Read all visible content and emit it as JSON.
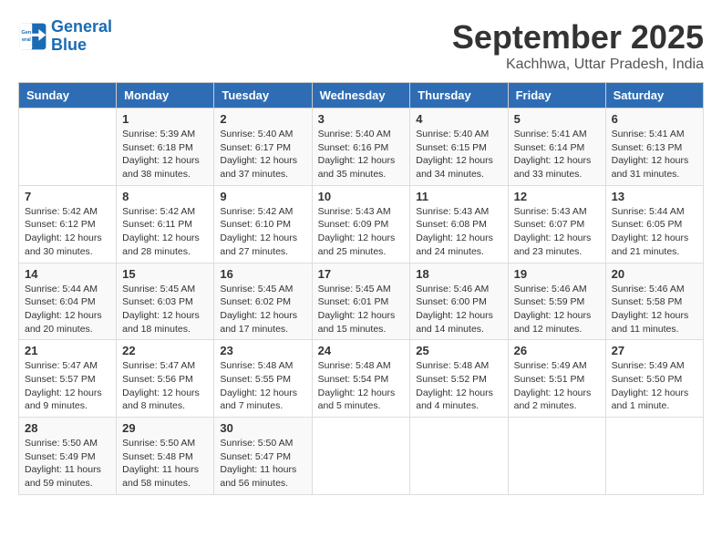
{
  "logo": {
    "line1": "General",
    "line2": "Blue"
  },
  "title": "September 2025",
  "location": "Kachhwa, Uttar Pradesh, India",
  "headers": [
    "Sunday",
    "Monday",
    "Tuesday",
    "Wednesday",
    "Thursday",
    "Friday",
    "Saturday"
  ],
  "weeks": [
    [
      null,
      {
        "day": "1",
        "sunrise": "Sunrise: 5:39 AM",
        "sunset": "Sunset: 6:18 PM",
        "daylight": "Daylight: 12 hours and 38 minutes."
      },
      {
        "day": "2",
        "sunrise": "Sunrise: 5:40 AM",
        "sunset": "Sunset: 6:17 PM",
        "daylight": "Daylight: 12 hours and 37 minutes."
      },
      {
        "day": "3",
        "sunrise": "Sunrise: 5:40 AM",
        "sunset": "Sunset: 6:16 PM",
        "daylight": "Daylight: 12 hours and 35 minutes."
      },
      {
        "day": "4",
        "sunrise": "Sunrise: 5:40 AM",
        "sunset": "Sunset: 6:15 PM",
        "daylight": "Daylight: 12 hours and 34 minutes."
      },
      {
        "day": "5",
        "sunrise": "Sunrise: 5:41 AM",
        "sunset": "Sunset: 6:14 PM",
        "daylight": "Daylight: 12 hours and 33 minutes."
      },
      {
        "day": "6",
        "sunrise": "Sunrise: 5:41 AM",
        "sunset": "Sunset: 6:13 PM",
        "daylight": "Daylight: 12 hours and 31 minutes."
      }
    ],
    [
      {
        "day": "7",
        "sunrise": "Sunrise: 5:42 AM",
        "sunset": "Sunset: 6:12 PM",
        "daylight": "Daylight: 12 hours and 30 minutes."
      },
      {
        "day": "8",
        "sunrise": "Sunrise: 5:42 AM",
        "sunset": "Sunset: 6:11 PM",
        "daylight": "Daylight: 12 hours and 28 minutes."
      },
      {
        "day": "9",
        "sunrise": "Sunrise: 5:42 AM",
        "sunset": "Sunset: 6:10 PM",
        "daylight": "Daylight: 12 hours and 27 minutes."
      },
      {
        "day": "10",
        "sunrise": "Sunrise: 5:43 AM",
        "sunset": "Sunset: 6:09 PM",
        "daylight": "Daylight: 12 hours and 25 minutes."
      },
      {
        "day": "11",
        "sunrise": "Sunrise: 5:43 AM",
        "sunset": "Sunset: 6:08 PM",
        "daylight": "Daylight: 12 hours and 24 minutes."
      },
      {
        "day": "12",
        "sunrise": "Sunrise: 5:43 AM",
        "sunset": "Sunset: 6:07 PM",
        "daylight": "Daylight: 12 hours and 23 minutes."
      },
      {
        "day": "13",
        "sunrise": "Sunrise: 5:44 AM",
        "sunset": "Sunset: 6:05 PM",
        "daylight": "Daylight: 12 hours and 21 minutes."
      }
    ],
    [
      {
        "day": "14",
        "sunrise": "Sunrise: 5:44 AM",
        "sunset": "Sunset: 6:04 PM",
        "daylight": "Daylight: 12 hours and 20 minutes."
      },
      {
        "day": "15",
        "sunrise": "Sunrise: 5:45 AM",
        "sunset": "Sunset: 6:03 PM",
        "daylight": "Daylight: 12 hours and 18 minutes."
      },
      {
        "day": "16",
        "sunrise": "Sunrise: 5:45 AM",
        "sunset": "Sunset: 6:02 PM",
        "daylight": "Daylight: 12 hours and 17 minutes."
      },
      {
        "day": "17",
        "sunrise": "Sunrise: 5:45 AM",
        "sunset": "Sunset: 6:01 PM",
        "daylight": "Daylight: 12 hours and 15 minutes."
      },
      {
        "day": "18",
        "sunrise": "Sunrise: 5:46 AM",
        "sunset": "Sunset: 6:00 PM",
        "daylight": "Daylight: 12 hours and 14 minutes."
      },
      {
        "day": "19",
        "sunrise": "Sunrise: 5:46 AM",
        "sunset": "Sunset: 5:59 PM",
        "daylight": "Daylight: 12 hours and 12 minutes."
      },
      {
        "day": "20",
        "sunrise": "Sunrise: 5:46 AM",
        "sunset": "Sunset: 5:58 PM",
        "daylight": "Daylight: 12 hours and 11 minutes."
      }
    ],
    [
      {
        "day": "21",
        "sunrise": "Sunrise: 5:47 AM",
        "sunset": "Sunset: 5:57 PM",
        "daylight": "Daylight: 12 hours and 9 minutes."
      },
      {
        "day": "22",
        "sunrise": "Sunrise: 5:47 AM",
        "sunset": "Sunset: 5:56 PM",
        "daylight": "Daylight: 12 hours and 8 minutes."
      },
      {
        "day": "23",
        "sunrise": "Sunrise: 5:48 AM",
        "sunset": "Sunset: 5:55 PM",
        "daylight": "Daylight: 12 hours and 7 minutes."
      },
      {
        "day": "24",
        "sunrise": "Sunrise: 5:48 AM",
        "sunset": "Sunset: 5:54 PM",
        "daylight": "Daylight: 12 hours and 5 minutes."
      },
      {
        "day": "25",
        "sunrise": "Sunrise: 5:48 AM",
        "sunset": "Sunset: 5:52 PM",
        "daylight": "Daylight: 12 hours and 4 minutes."
      },
      {
        "day": "26",
        "sunrise": "Sunrise: 5:49 AM",
        "sunset": "Sunset: 5:51 PM",
        "daylight": "Daylight: 12 hours and 2 minutes."
      },
      {
        "day": "27",
        "sunrise": "Sunrise: 5:49 AM",
        "sunset": "Sunset: 5:50 PM",
        "daylight": "Daylight: 12 hours and 1 minute."
      }
    ],
    [
      {
        "day": "28",
        "sunrise": "Sunrise: 5:50 AM",
        "sunset": "Sunset: 5:49 PM",
        "daylight": "Daylight: 11 hours and 59 minutes."
      },
      {
        "day": "29",
        "sunrise": "Sunrise: 5:50 AM",
        "sunset": "Sunset: 5:48 PM",
        "daylight": "Daylight: 11 hours and 58 minutes."
      },
      {
        "day": "30",
        "sunrise": "Sunrise: 5:50 AM",
        "sunset": "Sunset: 5:47 PM",
        "daylight": "Daylight: 11 hours and 56 minutes."
      },
      null,
      null,
      null,
      null
    ]
  ]
}
